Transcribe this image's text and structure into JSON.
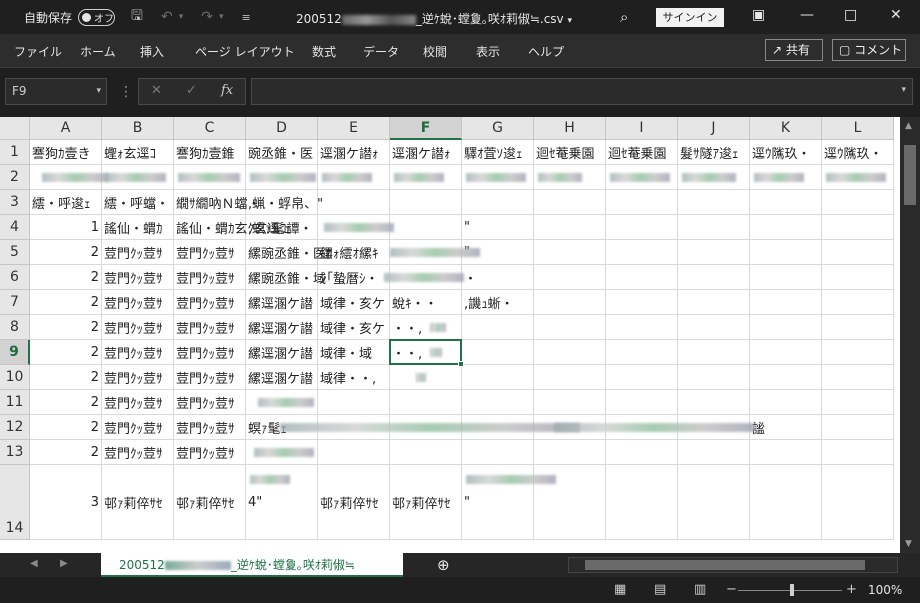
{
  "titlebar": {
    "autosave_label": "自動保存",
    "autosave_state": "オフ",
    "filename_prefix": "200512",
    "filename_suffix": "_逆ｹ蛻･螳夐｡咲ｵ莉俶≒.csv",
    "signin": "サインイン"
  },
  "ribbon": {
    "tabs": [
      "ファイル",
      "ホーム",
      "挿入",
      "ページ レイアウト",
      "数式",
      "データ",
      "校閲",
      "表示",
      "ヘルプ"
    ],
    "share": "共有",
    "comment": "コメント"
  },
  "formula_bar": {
    "namebox": "F9",
    "fx": "fx",
    "content": ""
  },
  "grid": {
    "columns": [
      "A",
      "B",
      "C",
      "D",
      "E",
      "F",
      "G",
      "H",
      "I",
      "J",
      "K",
      "L"
    ],
    "selected_column": "F",
    "selected_row": "9",
    "rows": [
      {
        "num": "1",
        "cells": [
          "謇狗ｶ壹き",
          "蟶ｫ玄逕ｺ",
          "謇狗ｶ壹錐",
          "豌丞錐・医",
          "逕溷ケ譛ｫ",
          "逕溷ケ譛ｫ",
          "驛ｵ萓ｿ逡ｪ",
          "迴ｾ菴乗園",
          "迴ｾ菴乗園",
          "髮ｻ隧ｱ逡ｪ",
          "逕ｳ隲玖・",
          "逕ｳ隲玖・"
        ]
      },
      {
        "num": "2",
        "cells": [
          "",
          "",
          "",
          "",
          "",
          "",
          "",
          "",
          "",
          "",
          "",
          ""
        ]
      },
      {
        "num": "3",
        "cells": [
          "繧・呼逡ｪ",
          "繧・呼蟷・",
          "繝ｻ繝吶Ｎ蟷・",
          ",蝋・蜉帛、\"",
          "",
          "",
          "",
          "",
          "",
          "",
          "",
          ""
        ]
      },
      {
        "num": "4",
        "cells": [
          "1",
          "謠仙・蝟ｶ",
          "謠仙・蝟ｶ玄ｸ玄逕ｺ譚・",
          ",螟ｧ髦ｪ",
          "",
          "",
          "\"",
          "",
          "",
          "",
          "",
          ""
        ]
      },
      {
        "num": "5",
        "cells": [
          "2",
          "荳門ｸｯ荳ｻ",
          "荳門ｸｯ荳ｻ",
          "縲豌丞錐・医ｶ",
          "縲ｫ繧ｵ縲ｷ",
          "",
          "\"",
          "",
          "",
          "",
          "",
          ""
        ]
      },
      {
        "num": "6",
        "cells": [
          "2",
          "荳門ｸｯ荳ｻ",
          "荳門ｸｯ荳ｻ",
          "縲豌丞錐・域",
          "ｼ｢蟄暦ｼ・",
          "",
          "・",
          "",
          "",
          "",
          "",
          ""
        ]
      },
      {
        "num": "7",
        "cells": [
          "2",
          "荳門ｸｯ荳ｻ",
          "荳門ｸｯ荳ｻ",
          "縲逕溷ケ譛",
          "域律・亥ケ",
          "蛻ｷ・・",
          ",譏ｭ蜥・",
          "",
          "",
          "",
          "",
          ""
        ]
      },
      {
        "num": "8",
        "cells": [
          "2",
          "荳門ｸｯ荳ｻ",
          "荳門ｸｯ荳ｻ",
          "縲逕溷ケ譛",
          "域律・亥ケ",
          "・・,",
          "",
          "",
          "",
          "",
          "",
          ""
        ]
      },
      {
        "num": "9",
        "cells": [
          "2",
          "荳門ｸｯ荳ｻ",
          "荳門ｸｯ荳ｻ",
          "縲逕溷ケ譛",
          "域律・域",
          "・・,",
          "",
          "",
          "",
          "",
          "",
          ""
        ]
      },
      {
        "num": "10",
        "cells": [
          "2",
          "荳門ｸｯ荳ｻ",
          "荳門ｸｯ荳ｻ",
          "縲逕溷ケ譛",
          "域律・・,",
          "",
          "",
          "",
          "",
          "",
          "",
          ""
        ]
      },
      {
        "num": "11",
        "cells": [
          "2",
          "荳門ｸｯ荳ｻ",
          "荳門ｸｯ荳ｻ",
          "",
          "",
          "",
          "",
          "",
          "",
          "",
          "",
          ""
        ]
      },
      {
        "num": "12",
        "cells": [
          "2",
          "荳門ｸｯ荳ｻ",
          "荳門ｸｯ荳ｻ",
          "螟ｧ髦ｪ",
          "",
          "",
          "",
          "",
          "",
          "",
          "謐",
          ""
        ]
      },
      {
        "num": "13",
        "cells": [
          "2",
          "荳門ｸｯ荳ｻ",
          "荳門ｸｯ荳ｻ",
          "",
          "",
          "",
          "",
          "",
          "",
          "",
          "",
          ""
        ]
      },
      {
        "num": "14",
        "cells": [
          "3",
          "邨ｧ莉倅ｻｾ",
          "邨ｧ莉倅ｻｾ",
          "4\"",
          "邨ｧ莉倅ｻｾ",
          "邨ｧ莉倅ｻｾ",
          "\"",
          "",
          "",
          "",
          "",
          ""
        ]
      }
    ]
  },
  "sheet": {
    "tab_prefix": "200512",
    "tab_suffix": "_逆ｹ蛻･螳夐｡咲ｵ莉俶≒"
  },
  "status": {
    "zoom": "100%"
  }
}
